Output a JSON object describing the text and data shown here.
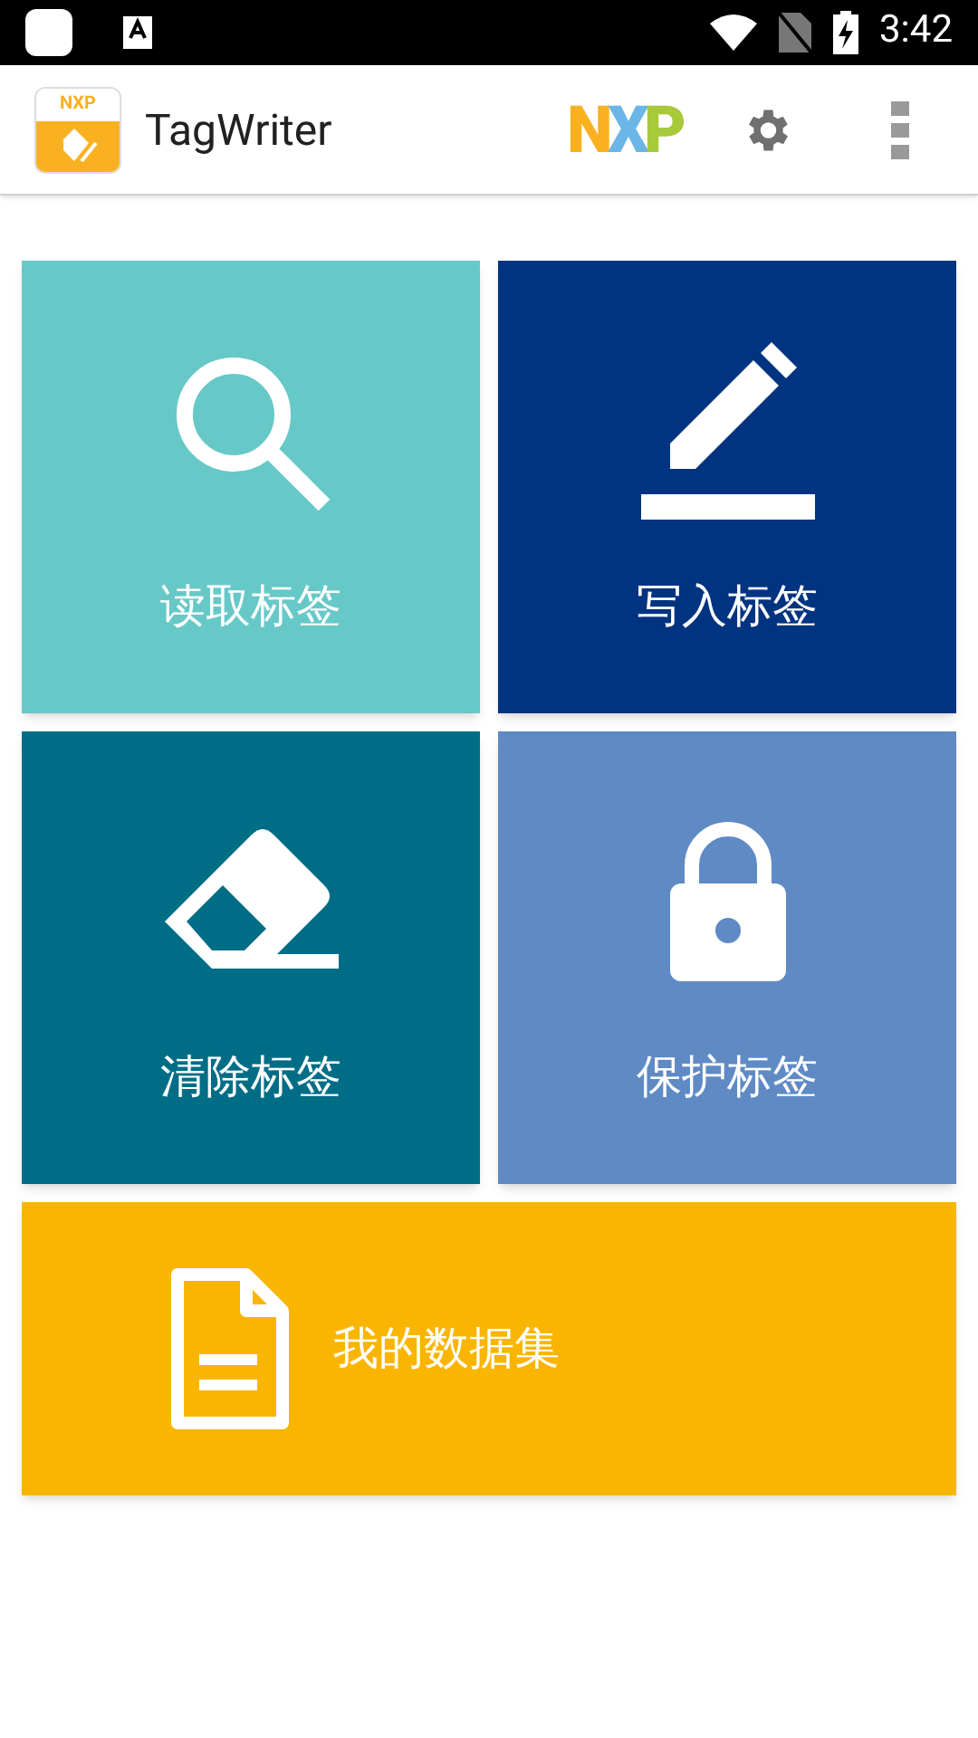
{
  "status_bar": {
    "time": "3:42"
  },
  "app_bar": {
    "app_icon_logo": "NXP",
    "title": "TagWriter",
    "brand_logo": "NXP"
  },
  "tiles": [
    {
      "kind": "read",
      "label": "读取标签",
      "color": "#67c8c8"
    },
    {
      "kind": "write",
      "label": "写入标签",
      "color": "#003380"
    },
    {
      "kind": "erase",
      "label": "清除标签",
      "color": "#006d86"
    },
    {
      "kind": "protect",
      "label": "保护标签",
      "color": "#5f8ac4"
    },
    {
      "kind": "datasets",
      "label": "我的数据集",
      "color": "#f9b500"
    }
  ]
}
